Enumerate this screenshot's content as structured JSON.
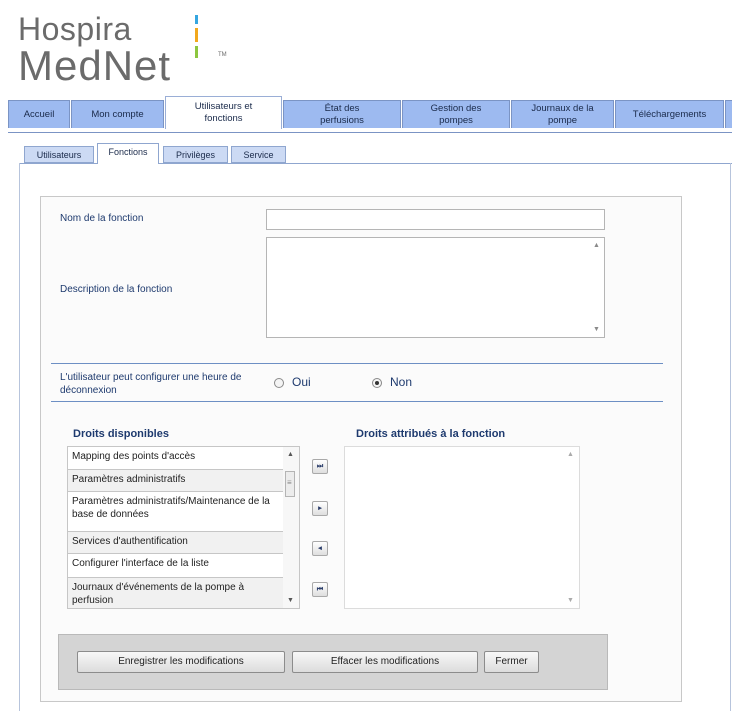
{
  "logo": {
    "line1": "Hospira",
    "line2": "MedNet",
    "tm": "TM"
  },
  "main_tabs": [
    {
      "label": "Accueil"
    },
    {
      "label": "Mon compte"
    },
    {
      "label": "Utilisateurs et fonctions"
    },
    {
      "label": "État des perfusions"
    },
    {
      "label": "Gestion des pompes"
    },
    {
      "label": "Journaux de la pompe"
    },
    {
      "label": "Téléchargements"
    }
  ],
  "sub_tabs": [
    {
      "label": "Utilisateurs"
    },
    {
      "label": "Fonctions"
    },
    {
      "label": "Privilèges"
    },
    {
      "label": "Service"
    }
  ],
  "form": {
    "name_label": "Nom de la fonction",
    "name_value": "",
    "description_label": "Description de la fonction",
    "description_value": "",
    "logout_label_line1": "L'utilisateur peut configurer une heure de",
    "logout_label_line2": "déconnexion",
    "radio_yes": "Oui",
    "radio_no": "Non",
    "selected": "Non"
  },
  "rights": {
    "available_heading": "Droits disponibles",
    "assigned_heading": "Droits attribués à la fonction",
    "available": [
      "Mapping des points d'accès",
      "Paramètres administratifs",
      "Paramètres administratifs/Maintenance de la base de données",
      "Services d'authentification",
      "Configurer l'interface de la liste",
      "Journaux d'événements de la pompe à perfusion"
    ],
    "assigned": []
  },
  "move_buttons": {
    "all_right": "⏭",
    "right": "▸",
    "left": "◂",
    "all_left": "⏮"
  },
  "actions": {
    "save": "Enregistrer les modifications",
    "clear": "Effacer les modifications",
    "close": "Fermer"
  }
}
